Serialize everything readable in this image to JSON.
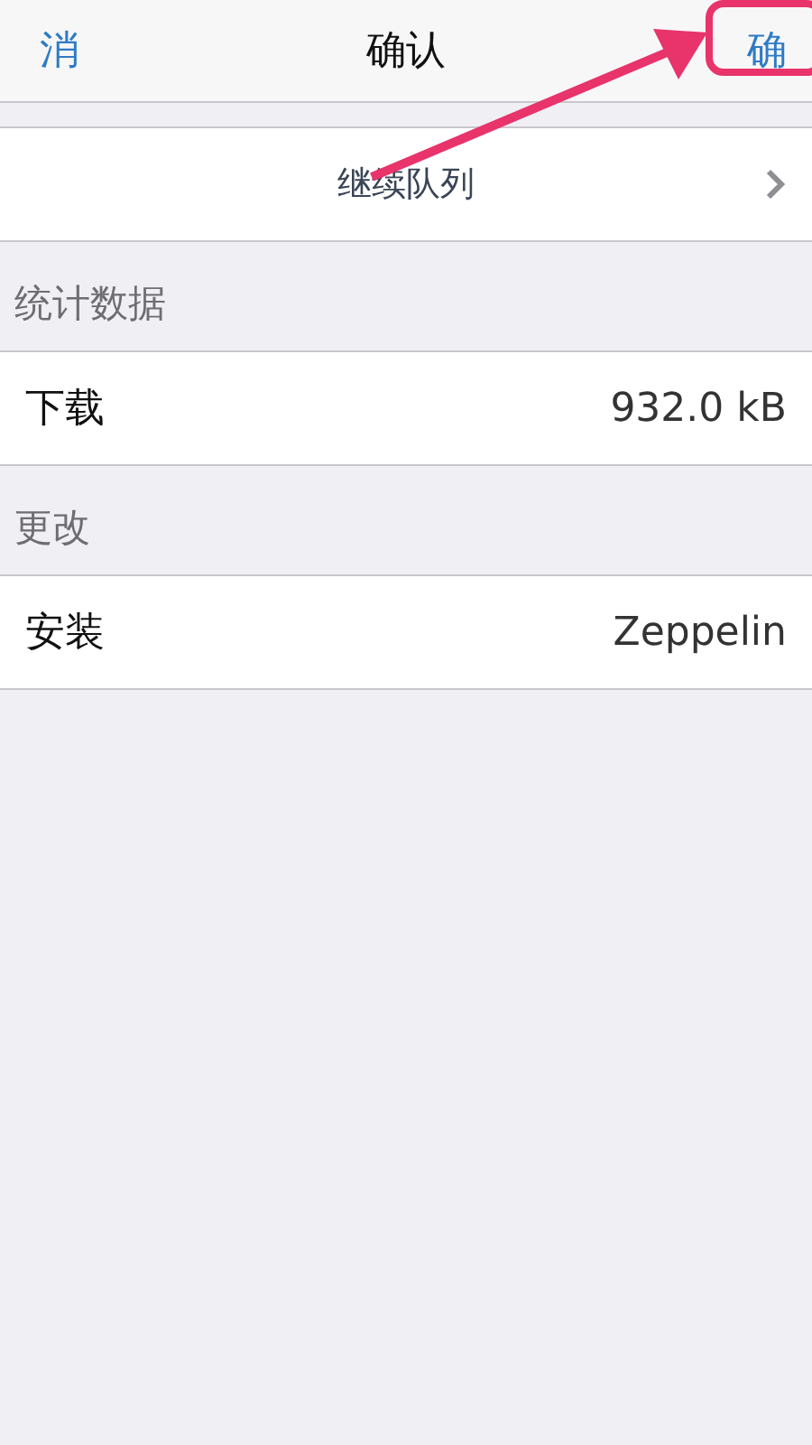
{
  "nav_bar": {
    "left_button": "消",
    "title": "确认",
    "right_button": "确"
  },
  "queue_row": {
    "label": "继续队列"
  },
  "sections": [
    {
      "header": "统计数据",
      "rows": [
        {
          "label": "下载",
          "value": "932.0 kB"
        }
      ]
    },
    {
      "header": "更改",
      "rows": [
        {
          "label": "安装",
          "value": "Zeppelin"
        }
      ]
    }
  ]
}
